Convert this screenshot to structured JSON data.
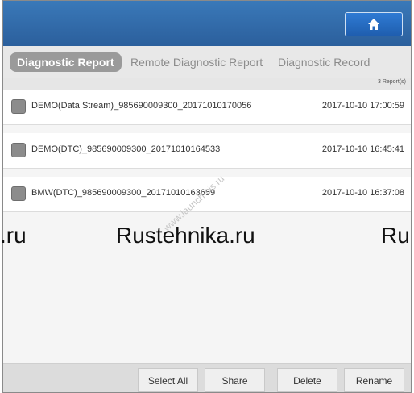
{
  "home_icon": "home-icon",
  "tabs": [
    {
      "label": "Diagnostic Report"
    },
    {
      "label": "Remote Diagnostic Report"
    },
    {
      "label": "Diagnostic Record"
    }
  ],
  "report_count": "3 Report(s)",
  "reports": [
    {
      "name": "DEMO(Data Stream)_985690009300_20171010170056",
      "date": "2017-10-10 17:00:59"
    },
    {
      "name": "DEMO(DTC)_985690009300_20171010164533",
      "date": "2017-10-10 16:45:41"
    },
    {
      "name": "BMW(DTC)_985690009300_20171010163659",
      "date": "2017-10-10 16:37:08"
    }
  ],
  "overlay": {
    "left": ".ru",
    "center": "Rustehnika.ru",
    "right": "Ru"
  },
  "watermark": "www.launch-cis.ru",
  "actions": {
    "select_all": "Select All",
    "share": "Share",
    "delete": "Delete",
    "rename": "Rename"
  }
}
